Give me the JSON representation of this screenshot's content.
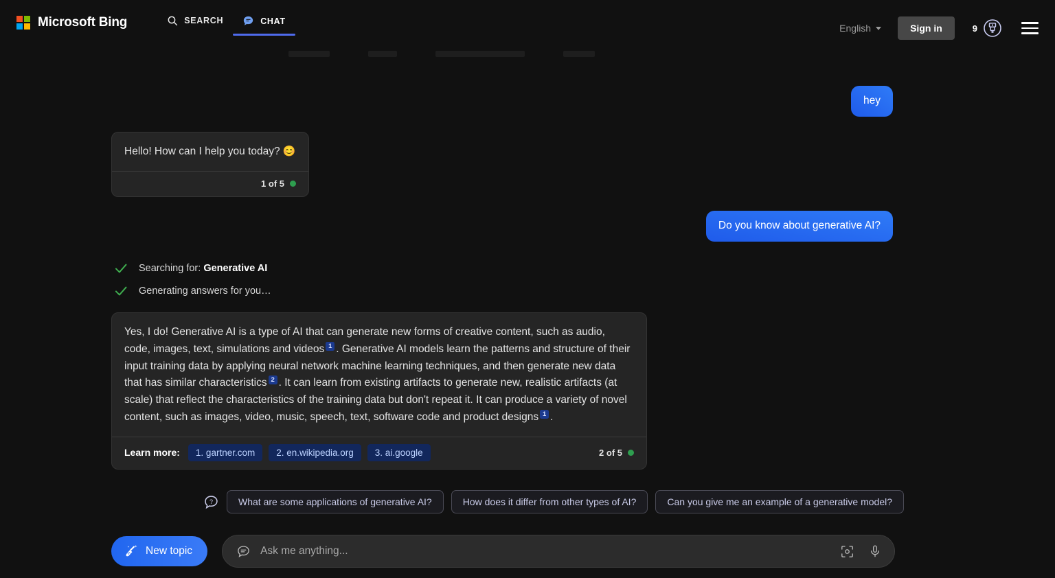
{
  "header": {
    "brand": "Microsoft Bing",
    "logo_colors": {
      "q1": "#f25022",
      "q2": "#7fba00",
      "q3": "#00a4ef",
      "q4": "#ffb900"
    },
    "tabs": [
      {
        "label": "SEARCH",
        "icon": "search-icon",
        "active": false
      },
      {
        "label": "CHAT",
        "icon": "chat-bubble-icon",
        "active": true
      }
    ],
    "language": "English",
    "sign_in": "Sign in",
    "rewards_count": "9",
    "rewards_icon": "rewards-medal-icon",
    "menu_icon": "hamburger-menu-icon",
    "accent": "#4f6bed"
  },
  "conversation": [
    {
      "role": "user",
      "text": "hey"
    },
    {
      "role": "bot",
      "text": "Hello! How can I help you today? ",
      "emoji": "😊",
      "counter": "1 of 5",
      "counter_dot": "#2e9e4f"
    },
    {
      "role": "user",
      "text": "Do you know about generative AI?"
    }
  ],
  "status": [
    {
      "icon": "check-icon",
      "prefix": "Searching for: ",
      "strong": "Generative AI"
    },
    {
      "icon": "check-icon",
      "prefix": "Generating answers for you…",
      "strong": ""
    }
  ],
  "answer": {
    "part1": "Yes, I do! Generative AI is a type of AI that can generate new forms of creative content, such as audio, code, images, text, simulations and videos",
    "cite1": "1",
    "part2": ". Generative AI models learn the patterns and structure of their input training data by applying neural network machine learning techniques, and then generate new data that has similar characteristics",
    "cite2": "2",
    "part3": ". It can learn from existing artifacts to generate new, realistic artifacts (at scale) that reflect the characteristics of the training data but don't repeat it. It can produce a variety of novel content, such as images, video, music, speech, text, software code and product designs",
    "cite3": "1",
    "part4": ".",
    "learn_more_label": "Learn more:",
    "sources": [
      {
        "label": "1. gartner.com"
      },
      {
        "label": "2. en.wikipedia.org"
      },
      {
        "label": "3. ai.google"
      }
    ],
    "counter": "2 of 5",
    "counter_dot": "#2e9e4f"
  },
  "suggestions": {
    "icon": "question-bubble-icon",
    "items": [
      {
        "label": "What are some applications of generative AI?"
      },
      {
        "label": "How does it differ from other types of AI?"
      },
      {
        "label": "Can you give me an example of a generative model?"
      }
    ]
  },
  "composer": {
    "new_topic_label": "New topic",
    "new_topic_icon": "broom-icon",
    "input_leading_icon": "chat-bubble-icon",
    "placeholder": "Ask me anything...",
    "camera_icon": "visual-search-camera-icon",
    "mic_icon": "microphone-icon"
  }
}
